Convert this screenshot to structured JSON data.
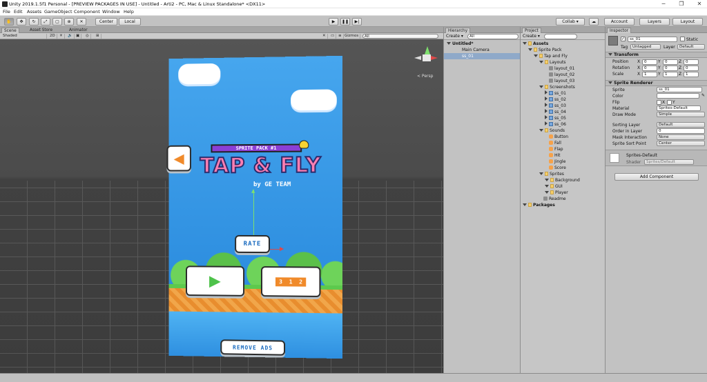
{
  "window": {
    "title": "Unity 2019.1.5f1 Personal - [PREVIEW PACKAGES IN USE] - Untitled - Arti2 - PC, Mac & Linux Standalone* <DX11>",
    "minimize": "─",
    "maximize": "❐",
    "close": "✕"
  },
  "menu": [
    "File",
    "Edit",
    "Assets",
    "GameObject",
    "Component",
    "Window",
    "Help"
  ],
  "toolbar": {
    "pivot": "Center",
    "space": "Local",
    "collab": "Collab ▾",
    "account": "Account",
    "layers": "Layers",
    "layout": "Layout"
  },
  "scene": {
    "tabs": [
      "Scene",
      "Asset Store",
      "Animator"
    ],
    "shading": "Shaded",
    "mode2d": "2D",
    "gizmos": "Gizmos",
    "search_placeholder": "All",
    "persp": "< Persp"
  },
  "game": {
    "title_badge": "SPRITE PACK #1",
    "title_main": "TAP & FLY",
    "subtitle": "by GE TEAM",
    "rate": "RATE",
    "remove_ads": "REMOVE ADS",
    "podium": "3  1  2"
  },
  "hierarchy": {
    "title": "Hierarchy",
    "create": "Create ▾",
    "search_placeholder": "All",
    "scene": "Untitled*",
    "items": [
      "Main Camera",
      "ss_01"
    ]
  },
  "project": {
    "title": "Project",
    "create": "Create ▾",
    "tree": [
      {
        "label": "Assets",
        "indent": 0,
        "kind": "folder",
        "bold": true
      },
      {
        "label": "Sprite Pack",
        "indent": 1,
        "kind": "folder"
      },
      {
        "label": "Tap and Fly",
        "indent": 2,
        "kind": "folder"
      },
      {
        "label": "Layouts",
        "indent": 3,
        "kind": "folder"
      },
      {
        "label": "layout_01",
        "indent": 4,
        "kind": "scene"
      },
      {
        "label": "layout_02",
        "indent": 4,
        "kind": "scene"
      },
      {
        "label": "layout_03",
        "indent": 4,
        "kind": "scene"
      },
      {
        "label": "Screenshots",
        "indent": 3,
        "kind": "folder"
      },
      {
        "label": "ss_01",
        "indent": 4,
        "kind": "sprite"
      },
      {
        "label": "ss_02",
        "indent": 4,
        "kind": "sprite"
      },
      {
        "label": "ss_03",
        "indent": 4,
        "kind": "sprite"
      },
      {
        "label": "ss_04",
        "indent": 4,
        "kind": "sprite"
      },
      {
        "label": "ss_05",
        "indent": 4,
        "kind": "sprite"
      },
      {
        "label": "ss_06",
        "indent": 4,
        "kind": "sprite"
      },
      {
        "label": "Sounds",
        "indent": 3,
        "kind": "folder"
      },
      {
        "label": "Button",
        "indent": 4,
        "kind": "audio"
      },
      {
        "label": "Fall",
        "indent": 4,
        "kind": "audio"
      },
      {
        "label": "Flap",
        "indent": 4,
        "kind": "audio"
      },
      {
        "label": "Hit",
        "indent": 4,
        "kind": "audio"
      },
      {
        "label": "Jingle",
        "indent": 4,
        "kind": "audio"
      },
      {
        "label": "Score",
        "indent": 4,
        "kind": "audio"
      },
      {
        "label": "Sprites",
        "indent": 3,
        "kind": "folder"
      },
      {
        "label": "Background",
        "indent": 4,
        "kind": "folder"
      },
      {
        "label": "GUI",
        "indent": 4,
        "kind": "folder"
      },
      {
        "label": "Player",
        "indent": 4,
        "kind": "folder"
      },
      {
        "label": "Readme",
        "indent": 3,
        "kind": "file"
      },
      {
        "label": "Packages",
        "indent": 0,
        "kind": "folder",
        "bold": true
      }
    ]
  },
  "inspector": {
    "title": "Inspector",
    "name": "ss_01",
    "static": "Static",
    "tag_label": "Tag",
    "tag": "Untagged",
    "layer_label": "Layer",
    "layer": "Default",
    "transform": {
      "title": "Transform",
      "rows": [
        {
          "label": "Position",
          "x": "0",
          "y": "0",
          "z": "0"
        },
        {
          "label": "Rotation",
          "x": "0",
          "y": "0",
          "z": "0"
        },
        {
          "label": "Scale",
          "x": "1",
          "y": "1",
          "z": "1"
        }
      ]
    },
    "sprite_renderer": {
      "title": "Sprite Renderer",
      "sprite_label": "Sprite",
      "sprite": "ss_01",
      "color_label": "Color",
      "flip_label": "Flip",
      "flip_x": "X",
      "flip_y": "Y",
      "material_label": "Material",
      "material": "Sprites-Default",
      "draw_mode_label": "Draw Mode",
      "draw_mode": "Simple",
      "sorting_layer_label": "Sorting Layer",
      "sorting_layer": "Default",
      "order_label": "Order in Layer",
      "order": "0",
      "mask_label": "Mask Interaction",
      "mask": "None",
      "sort_point_label": "Sprite Sort Point",
      "sort_point": "Center"
    },
    "material": {
      "name": "Sprites-Default",
      "shader_label": "Shader",
      "shader": "Sprites/Default"
    },
    "add_component": "Add Component"
  },
  "colors": {
    "accent": "#3d7ec4",
    "selection": "#8fa9c9",
    "sky": "#2e8fe0"
  }
}
